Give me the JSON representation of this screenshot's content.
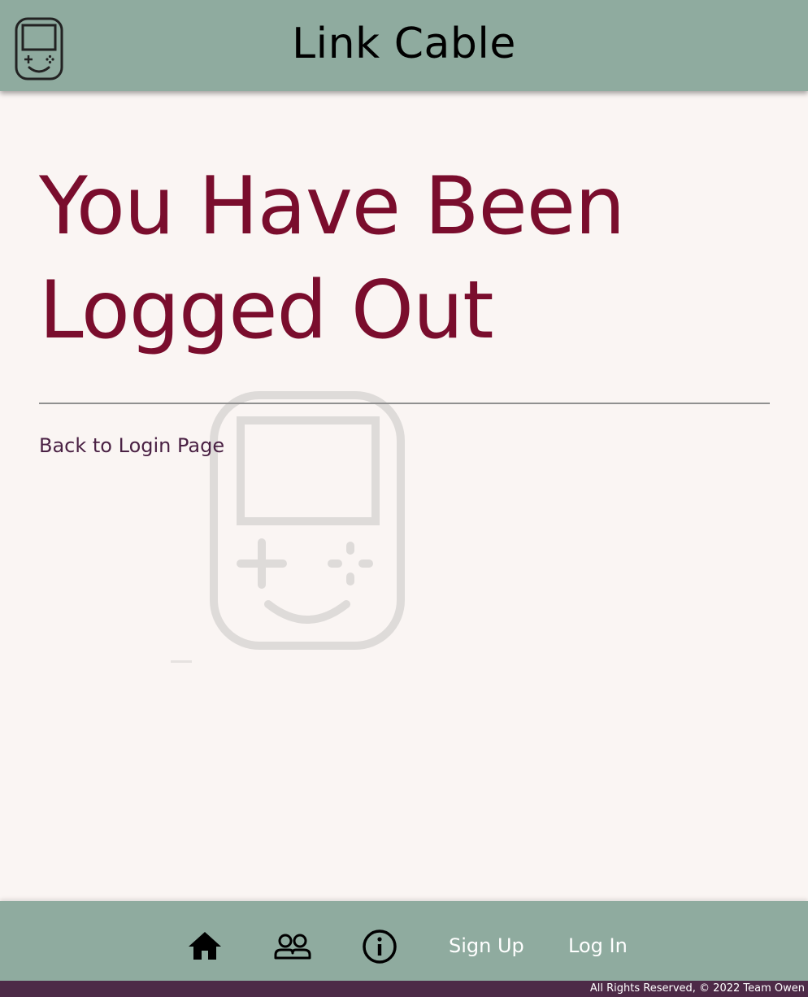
{
  "header": {
    "title": "Link Cable",
    "logo_icon": "handheld-console-icon"
  },
  "main": {
    "heading_line1": "You Have Been",
    "heading_line2": "Logged Out",
    "back_link": "Back to Login Page",
    "watermark_icon": "handheld-console-icon"
  },
  "footer": {
    "nav": {
      "home_icon": "home-icon",
      "people_icon": "people-icon",
      "info_icon": "info-icon",
      "signup_label": "Sign Up",
      "login_label": "Log In"
    },
    "copyright": "All Rights Reserved, © 2022 Team Owen"
  },
  "colors": {
    "header_bg": "#8fab9f",
    "page_bg": "#faf5f3",
    "heading": "#7a0d2d",
    "link": "#4a2144",
    "copyright_bg": "#4d2a47"
  }
}
